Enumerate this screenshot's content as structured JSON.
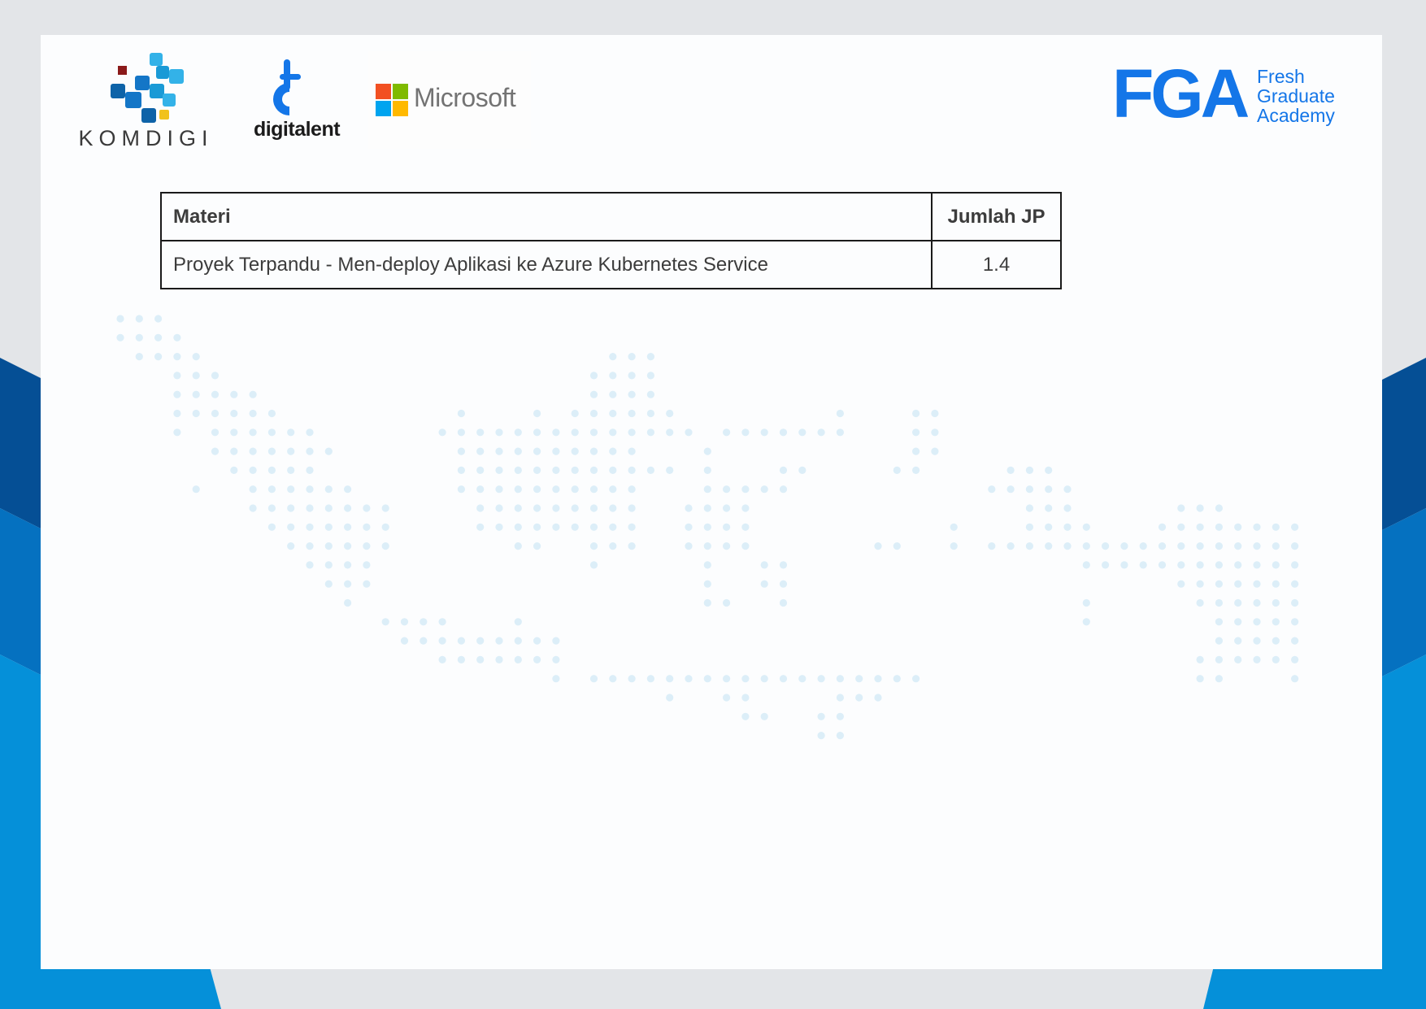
{
  "logos": {
    "komdigi": "KOMDIGI",
    "digitalent": "digitalent",
    "microsoft": "Microsoft",
    "fga": {
      "mark": "FGA",
      "lines": [
        "Fresh",
        "Graduate",
        "Academy"
      ]
    }
  },
  "table": {
    "headers": {
      "materi": "Materi",
      "jumlah_jp": "Jumlah JP"
    },
    "rows": [
      {
        "materi": "Proyek Terpandu - Men-deploy Aplikasi ke Azure Kubernetes Service",
        "jumlah_jp": "1.4"
      }
    ]
  },
  "colors": {
    "brand_blue": "#1476e8",
    "frame_dark": "#054f95",
    "frame_mid": "#0571c0",
    "frame_light": "#0590d9",
    "map_dots": "#dceef8"
  },
  "background": {
    "decoration": "dotted-indonesia-map"
  }
}
